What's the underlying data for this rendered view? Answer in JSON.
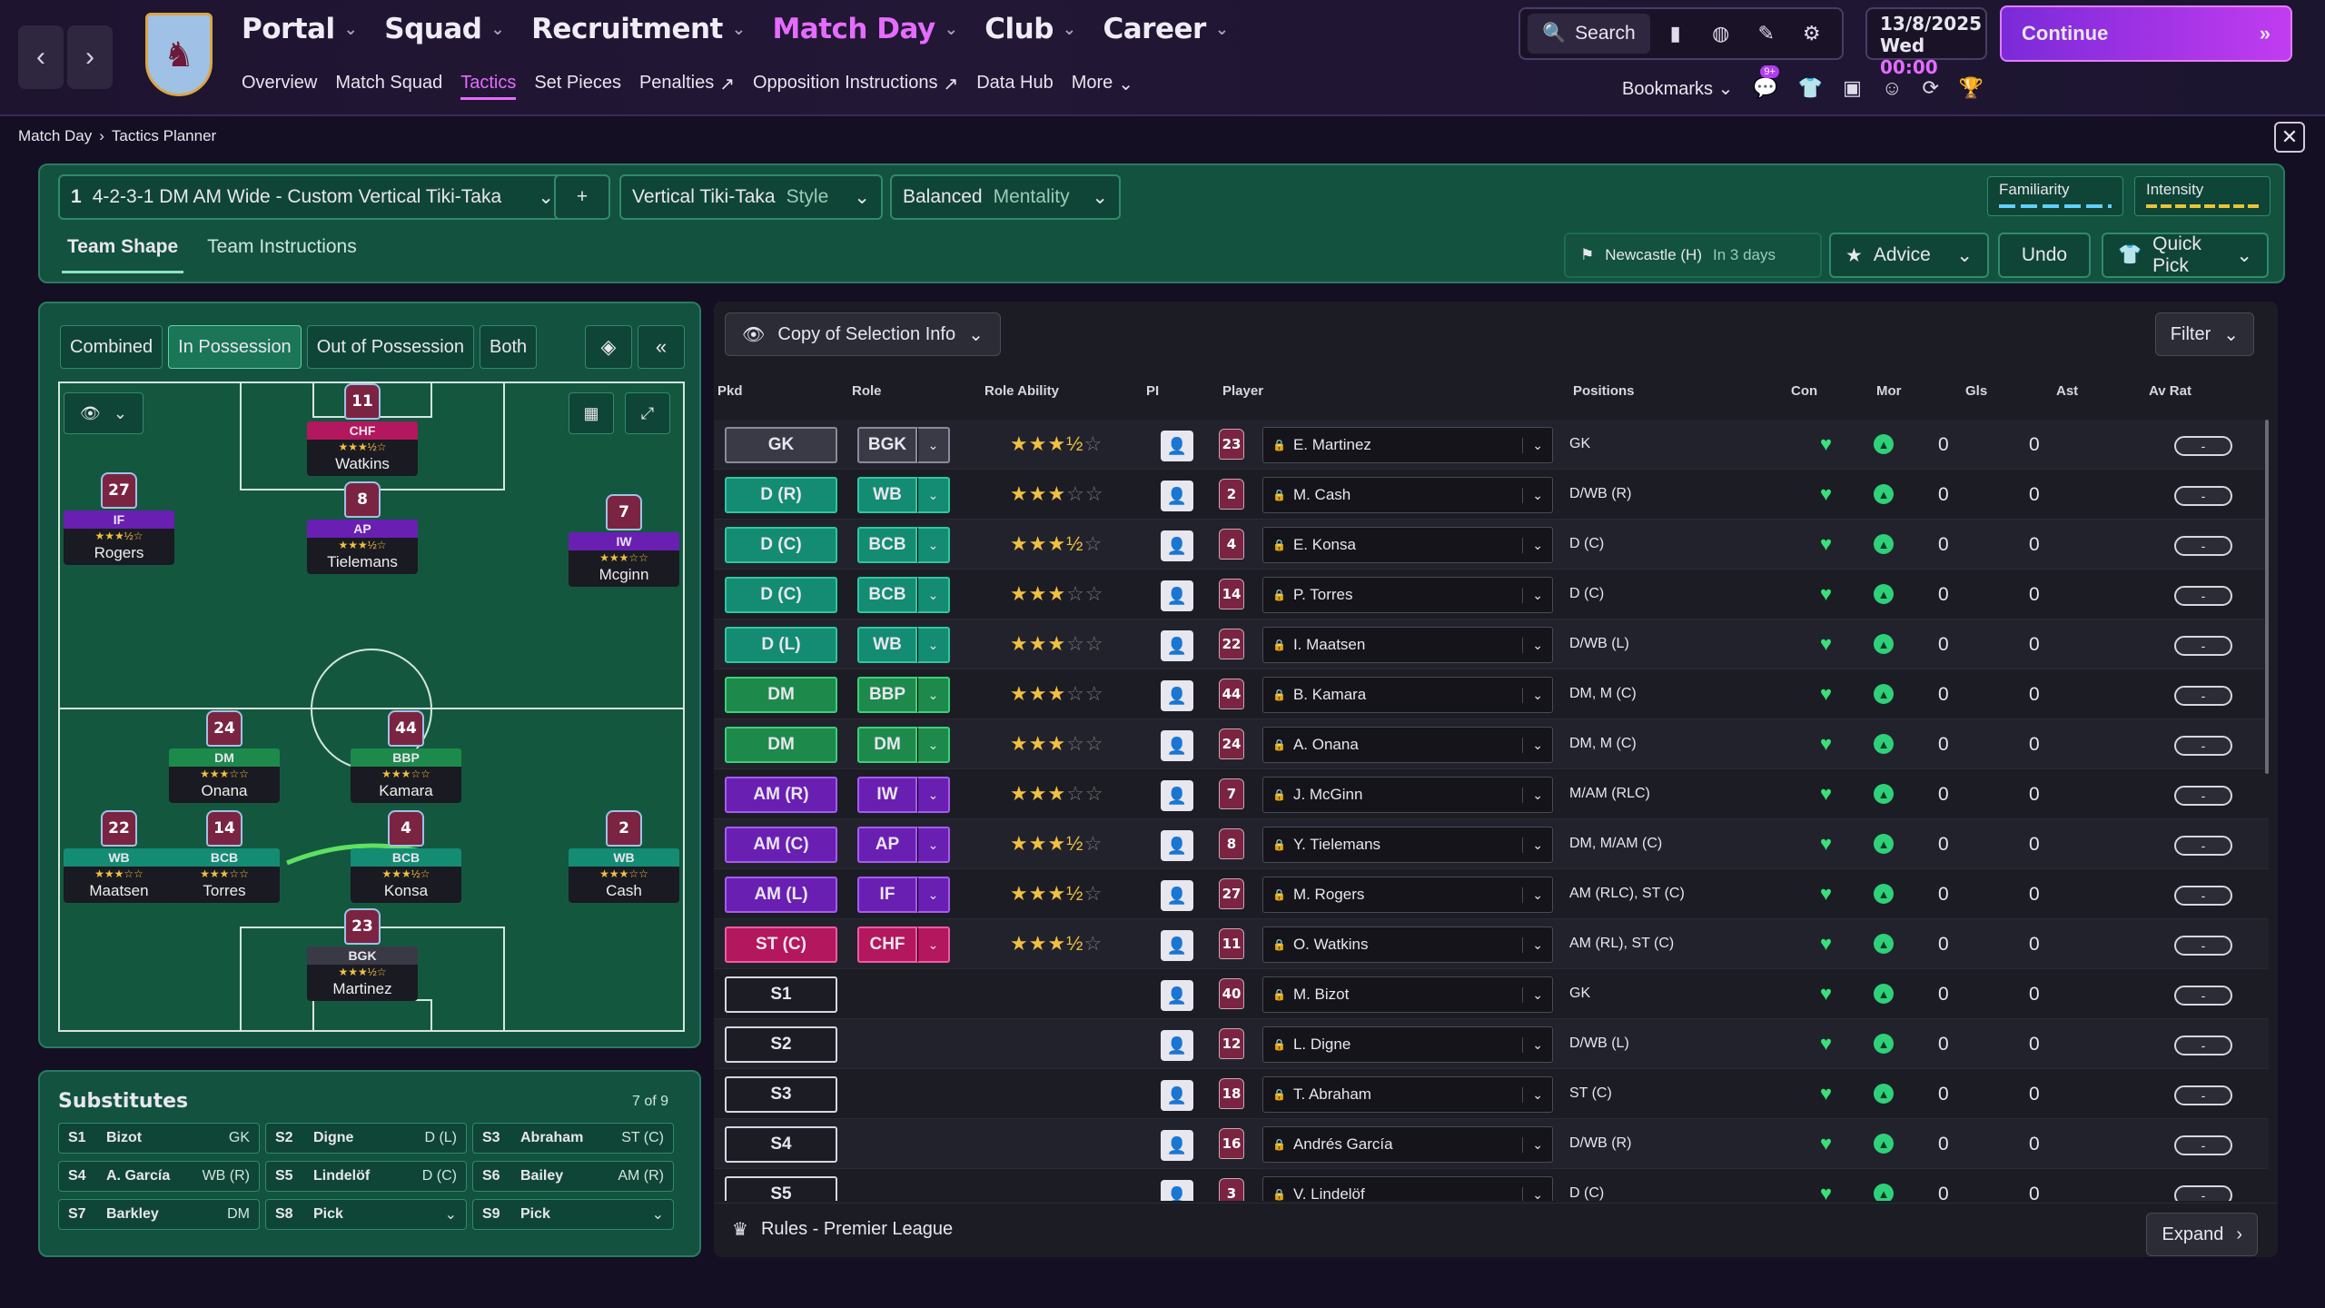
{
  "nav": {
    "back": "<",
    "forward": ">",
    "main": [
      {
        "label": "Portal",
        "active": false
      },
      {
        "label": "Squad",
        "active": false
      },
      {
        "label": "Recruitment",
        "active": false
      },
      {
        "label": "Match Day",
        "active": true
      },
      {
        "label": "Club",
        "active": false
      },
      {
        "label": "Career",
        "active": false
      }
    ],
    "sub": [
      "Overview",
      "Match Squad",
      "Tactics",
      "Set Pieces",
      "Penalties",
      "Opposition Instructions",
      "Data Hub",
      "More"
    ],
    "sub_active": "Tactics",
    "search": "Search",
    "date": "13/8/2025",
    "day": "Wed",
    "time": "00:00",
    "continue": "Continue",
    "bookmarks": "Bookmarks",
    "badge": "9+"
  },
  "breadcrumb": {
    "parent": "Match Day",
    "current": "Tactics Planner"
  },
  "tactic": {
    "slot": "1",
    "formation": "4-2-3-1 DM AM Wide - Custom Vertical Tiki-Taka",
    "add": "+",
    "style_value": "Vertical Tiki-Taka",
    "style_label": "Style",
    "mentality_value": "Balanced",
    "mentality_label": "Mentality",
    "familiarity": "Familiarity",
    "intensity": "Intensity",
    "tab_shape": "Team Shape",
    "tab_instructions": "Team Instructions",
    "next_match": "Newcastle (H)",
    "next_when": "In 3 days",
    "advice": "Advice",
    "undo": "Undo",
    "quick_pick": "Quick Pick"
  },
  "view_tabs": [
    "Combined",
    "In Possession",
    "Out of Possession",
    "Both"
  ],
  "view_active": "In Possession",
  "pitch_players": [
    {
      "num": "11",
      "role": "CHF",
      "stars": "★★★½☆",
      "name": "Watkins",
      "col": "#b3175e"
    },
    {
      "num": "27",
      "role": "IF",
      "stars": "★★★½☆",
      "name": "Rogers",
      "col": "#6a1fb3"
    },
    {
      "num": "8",
      "role": "AP",
      "stars": "★★★½☆",
      "name": "Tielemans",
      "col": "#6a1fb3"
    },
    {
      "num": "7",
      "role": "IW",
      "stars": "★★★☆☆",
      "name": "Mcginn",
      "col": "#6a1fb3"
    },
    {
      "num": "24",
      "role": "DM",
      "stars": "★★★☆☆",
      "name": "Onana",
      "col": "#1d8a4c"
    },
    {
      "num": "44",
      "role": "BBP",
      "stars": "★★★☆☆",
      "name": "Kamara",
      "col": "#1d8a4c"
    },
    {
      "num": "22",
      "role": "WB",
      "stars": "★★★☆☆",
      "name": "Maatsen",
      "col": "#138c73"
    },
    {
      "num": "14",
      "role": "BCB",
      "stars": "★★★☆☆",
      "name": "Torres",
      "col": "#138c73"
    },
    {
      "num": "4",
      "role": "BCB",
      "stars": "★★★½☆",
      "name": "Konsa",
      "col": "#138c73"
    },
    {
      "num": "2",
      "role": "WB",
      "stars": "★★★☆☆",
      "name": "Cash",
      "col": "#138c73"
    },
    {
      "num": "23",
      "role": "BGK",
      "stars": "★★★½☆",
      "name": "Martinez",
      "col": "#3a3a46"
    }
  ],
  "subs": {
    "title": "Substitutes",
    "count": "7 of 9",
    "items": [
      {
        "slot": "S1",
        "name": "Bizot",
        "pos": "GK"
      },
      {
        "slot": "S2",
        "name": "Digne",
        "pos": "D (L)"
      },
      {
        "slot": "S3",
        "name": "Abraham",
        "pos": "ST (C)"
      },
      {
        "slot": "S4",
        "name": "A. García",
        "pos": "WB (R)"
      },
      {
        "slot": "S5",
        "name": "Lindelöf",
        "pos": "D (C)"
      },
      {
        "slot": "S6",
        "name": "Bailey",
        "pos": "AM (R)"
      },
      {
        "slot": "S7",
        "name": "Barkley",
        "pos": "DM"
      },
      {
        "slot": "S8",
        "name": "Pick",
        "pos": "⌄"
      },
      {
        "slot": "S9",
        "name": "Pick",
        "pos": "⌄"
      }
    ]
  },
  "table": {
    "copy_btn": "Copy of Selection Info",
    "filter": "Filter",
    "headers": {
      "pkd": "Pkd",
      "role": "Role",
      "role_ability": "Role Ability",
      "pi": "PI",
      "player": "Player",
      "positions": "Positions",
      "con": "Con",
      "mor": "Mor",
      "gls": "Gls",
      "ast": "Ast",
      "avrat": "Av Rat"
    },
    "rows": [
      {
        "pkd": "GK",
        "cls": "c-gk",
        "role": "BGK",
        "stars": "★★★½",
        "empty": "☆",
        "num": "23",
        "player": "E. Martinez",
        "positions": "GK",
        "gls": "0",
        "ast": "0",
        "rat": "-"
      },
      {
        "pkd": "D (R)",
        "cls": "c-d",
        "role": "WB",
        "stars": "★★★",
        "empty": "☆☆",
        "num": "2",
        "player": "M. Cash",
        "positions": "D/WB (R)",
        "gls": "0",
        "ast": "0",
        "rat": "-"
      },
      {
        "pkd": "D (C)",
        "cls": "c-d",
        "role": "BCB",
        "stars": "★★★½",
        "empty": "☆",
        "num": "4",
        "player": "E. Konsa",
        "positions": "D (C)",
        "gls": "0",
        "ast": "0",
        "rat": "-"
      },
      {
        "pkd": "D (C)",
        "cls": "c-d",
        "role": "BCB",
        "stars": "★★★",
        "empty": "☆☆",
        "num": "14",
        "player": "P. Torres",
        "positions": "D (C)",
        "gls": "0",
        "ast": "0",
        "rat": "-"
      },
      {
        "pkd": "D (L)",
        "cls": "c-d",
        "role": "WB",
        "stars": "★★★",
        "empty": "☆☆",
        "num": "22",
        "player": "I. Maatsen",
        "positions": "D/WB (L)",
        "gls": "0",
        "ast": "0",
        "rat": "-"
      },
      {
        "pkd": "DM",
        "cls": "c-dm",
        "role": "BBP",
        "stars": "★★★",
        "empty": "☆☆",
        "num": "44",
        "player": "B. Kamara",
        "positions": "DM, M (C)",
        "gls": "0",
        "ast": "0",
        "rat": "-"
      },
      {
        "pkd": "DM",
        "cls": "c-dm",
        "role": "DM",
        "stars": "★★★",
        "empty": "☆☆",
        "num": "24",
        "player": "A. Onana",
        "positions": "DM, M (C)",
        "gls": "0",
        "ast": "0",
        "rat": "-"
      },
      {
        "pkd": "AM (R)",
        "cls": "c-am",
        "role": "IW",
        "stars": "★★★",
        "empty": "☆☆",
        "num": "7",
        "player": "J. McGinn",
        "positions": "M/AM (RLC)",
        "gls": "0",
        "ast": "0",
        "rat": "-"
      },
      {
        "pkd": "AM (C)",
        "cls": "c-am",
        "role": "AP",
        "stars": "★★★½",
        "empty": "☆",
        "num": "8",
        "player": "Y. Tielemans",
        "positions": "DM, M/AM (C)",
        "gls": "0",
        "ast": "0",
        "rat": "-"
      },
      {
        "pkd": "AM (L)",
        "cls": "c-am",
        "role": "IF",
        "stars": "★★★½",
        "empty": "☆",
        "num": "27",
        "player": "M. Rogers",
        "positions": "AM (RLC), ST (C)",
        "gls": "0",
        "ast": "0",
        "rat": "-"
      },
      {
        "pkd": "ST (C)",
        "cls": "c-st",
        "role": "CHF",
        "stars": "★★★½",
        "empty": "☆",
        "num": "11",
        "player": "O. Watkins",
        "positions": "AM (RL), ST (C)",
        "gls": "0",
        "ast": "0",
        "rat": "-"
      },
      {
        "pkd": "S1",
        "cls": "c-s",
        "role": "",
        "stars": "",
        "empty": "",
        "num": "40",
        "player": "M. Bizot",
        "positions": "GK",
        "gls": "0",
        "ast": "0",
        "rat": "-"
      },
      {
        "pkd": "S2",
        "cls": "c-s",
        "role": "",
        "stars": "",
        "empty": "",
        "num": "12",
        "player": "L. Digne",
        "positions": "D/WB (L)",
        "gls": "0",
        "ast": "0",
        "rat": "-"
      },
      {
        "pkd": "S3",
        "cls": "c-s",
        "role": "",
        "stars": "",
        "empty": "",
        "num": "18",
        "player": "T. Abraham",
        "positions": "ST (C)",
        "gls": "0",
        "ast": "0",
        "rat": "-"
      },
      {
        "pkd": "S4",
        "cls": "c-s",
        "role": "",
        "stars": "",
        "empty": "",
        "num": "16",
        "player": "Andrés García",
        "positions": "D/WB (R)",
        "gls": "0",
        "ast": "0",
        "rat": "-"
      },
      {
        "pkd": "S5",
        "cls": "c-s",
        "role": "",
        "stars": "",
        "empty": "",
        "num": "3",
        "player": "V. Lindelöf",
        "positions": "D (C)",
        "gls": "0",
        "ast": "0",
        "rat": "-"
      }
    ],
    "rules": "Rules - Premier League",
    "expand": "Expand"
  }
}
